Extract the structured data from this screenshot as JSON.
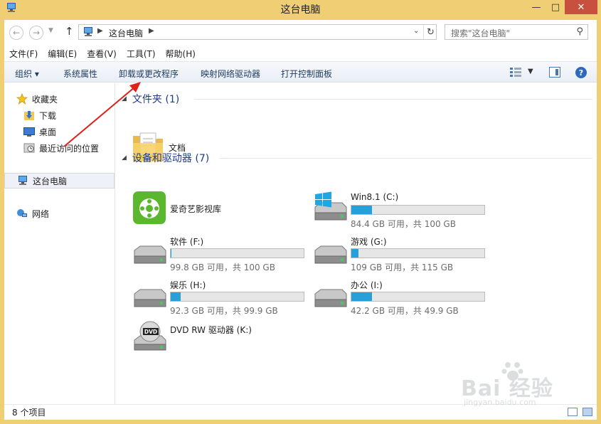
{
  "window": {
    "title": "这台电脑",
    "min": "—",
    "max": "□",
    "close": "✕"
  },
  "address": {
    "location": "这台电脑",
    "search_placeholder": "搜索\"这台电脑\""
  },
  "menu": [
    "文件(F)",
    "编辑(E)",
    "查看(V)",
    "工具(T)",
    "帮助(H)"
  ],
  "commands": {
    "organize": "组织 ▾",
    "properties": "系统属性",
    "uninstall": "卸载或更改程序",
    "map_drive": "映射网络驱动器",
    "control_panel": "打开控制面板"
  },
  "nav": {
    "favorites": "收藏夹",
    "downloads": "下载",
    "desktop": "桌面",
    "recent": "最近访问的位置",
    "this_pc": "这台电脑",
    "network": "网络"
  },
  "groups": {
    "folders": "文件夹 (1)",
    "devices": "设备和驱动器 (7)"
  },
  "folders": [
    {
      "name": "文档"
    }
  ],
  "devices": [
    {
      "name": "爱奇艺影视库",
      "type": "app"
    },
    {
      "name": "Win8.1 (C:)",
      "free": "84.4 GB 可用，共 100 GB",
      "used_fraction": 0.156,
      "type": "windows"
    },
    {
      "name": "软件 (F:)",
      "free": "99.8 GB 可用，共 100 GB",
      "used_fraction": 0.002,
      "type": "drive"
    },
    {
      "name": "游戏 (G:)",
      "free": "109 GB 可用，共 115 GB",
      "used_fraction": 0.052,
      "type": "drive"
    },
    {
      "name": "娱乐 (H:)",
      "free": "92.3 GB 可用，共 99.9 GB",
      "used_fraction": 0.076,
      "type": "drive"
    },
    {
      "name": "办公 (I:)",
      "free": "42.2 GB 可用，共 49.9 GB",
      "used_fraction": 0.154,
      "type": "drive"
    },
    {
      "name": "DVD RW 驱动器 (K:)",
      "type": "dvd",
      "icon_label": "DVD"
    }
  ],
  "status": {
    "count": "8 个项目"
  },
  "watermark": {
    "logo": "Bai  经验",
    "url": "jingyan.baidu.com"
  },
  "colors": {
    "frame": "#f0cf74",
    "close": "#c7503f",
    "accent_text": "#1e3a8a",
    "bar_fill": "#26a0da",
    "arrow": "#e0201b"
  }
}
